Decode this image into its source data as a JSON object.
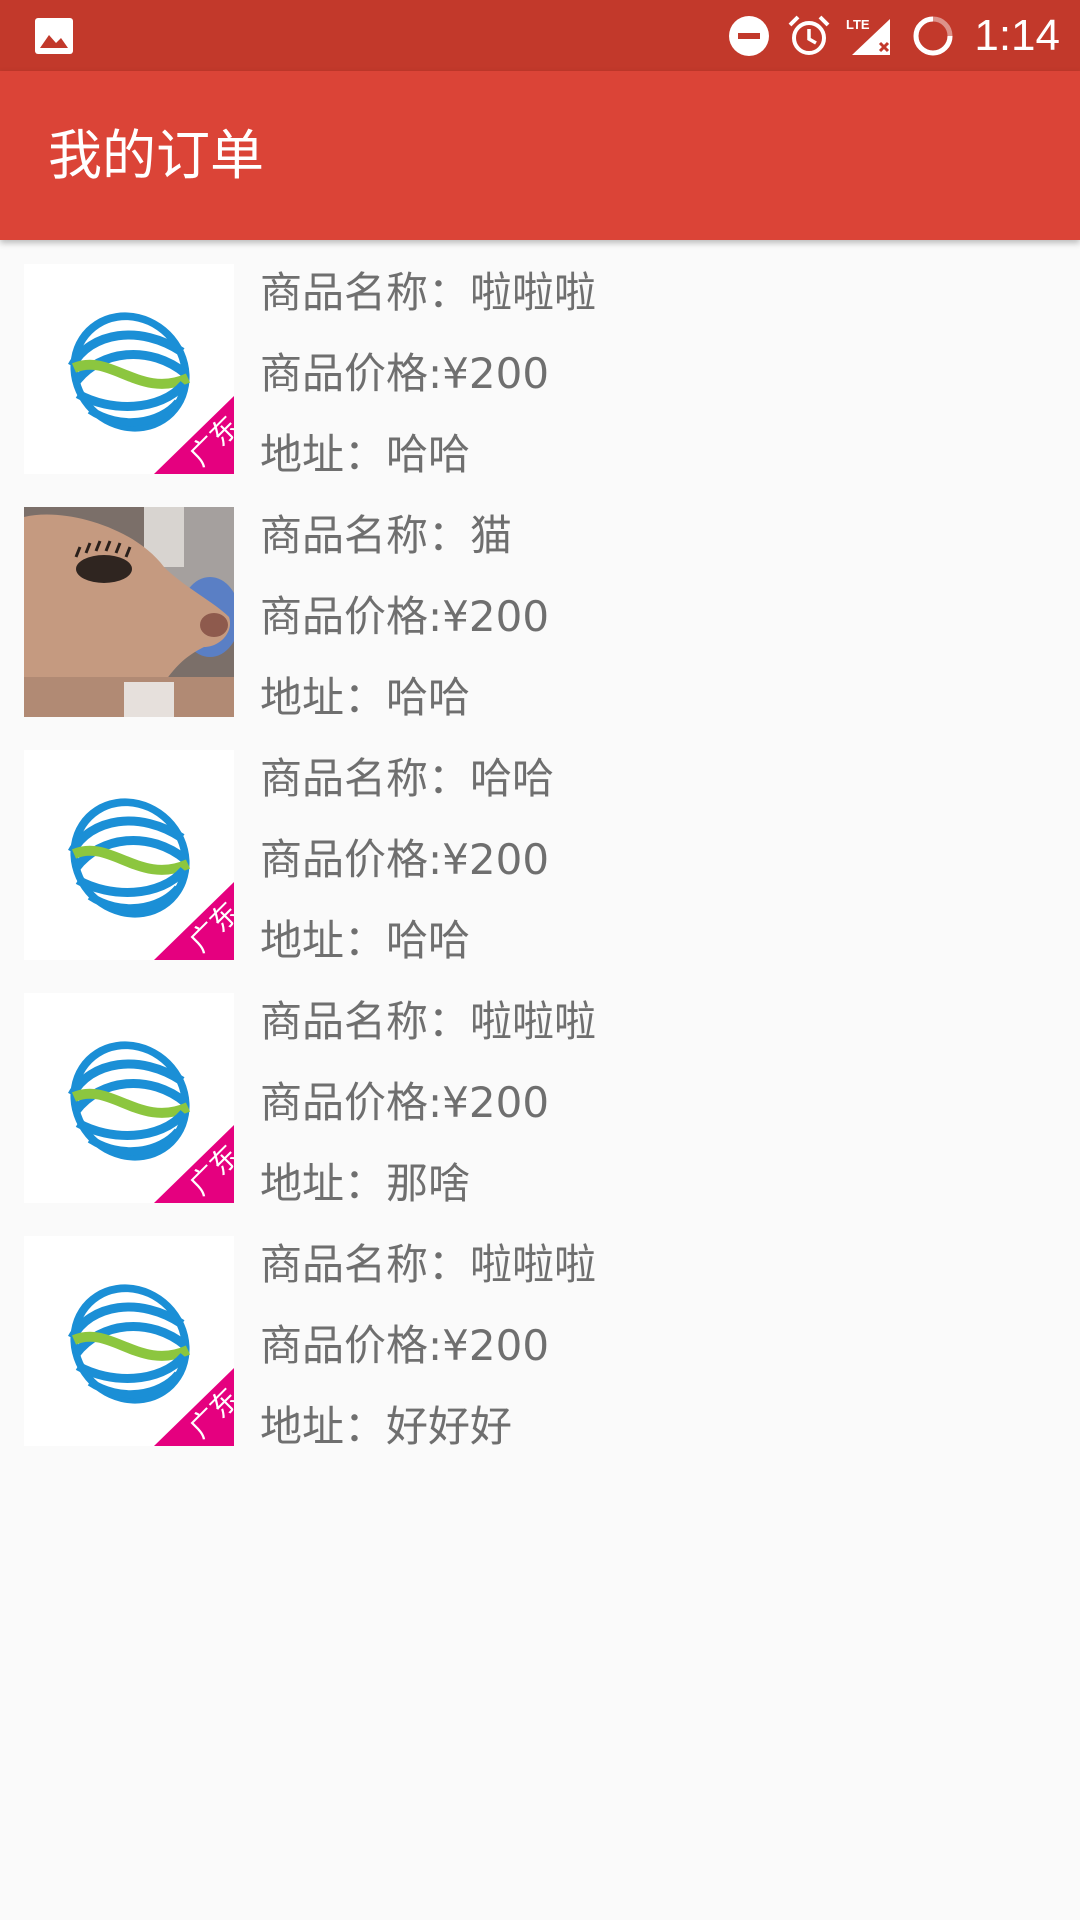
{
  "status_bar": {
    "time": "1:14",
    "icons": [
      "image-icon",
      "do-not-disturb-icon",
      "alarm-icon",
      "lte-signal-icon",
      "battery-loading-icon"
    ],
    "network_label": "LTE"
  },
  "app_bar": {
    "title": "我的订单"
  },
  "orders": [
    {
      "name": "商品名称：啦啦啦",
      "price": "商品价格:¥200",
      "address": "地址：哈哈",
      "image": "china-mobile-logo"
    },
    {
      "name": "商品名称：猫",
      "price": "商品价格:¥200",
      "address": "地址：哈哈",
      "image": "dog-photo"
    },
    {
      "name": "商品名称：哈哈",
      "price": "商品价格:¥200",
      "address": "地址：哈哈",
      "image": "china-mobile-logo"
    },
    {
      "name": "商品名称：啦啦啦",
      "price": "商品价格:¥200",
      "address": "地址：那啥",
      "image": "china-mobile-logo"
    },
    {
      "name": "商品名称：啦啦啦",
      "price": "商品价格:¥200",
      "address": "地址：好好好",
      "image": "china-mobile-logo"
    }
  ],
  "colors": {
    "status_bar": "#c2392b",
    "app_bar": "#db4437",
    "text": "#6f6f6f",
    "background": "#fafafa"
  }
}
